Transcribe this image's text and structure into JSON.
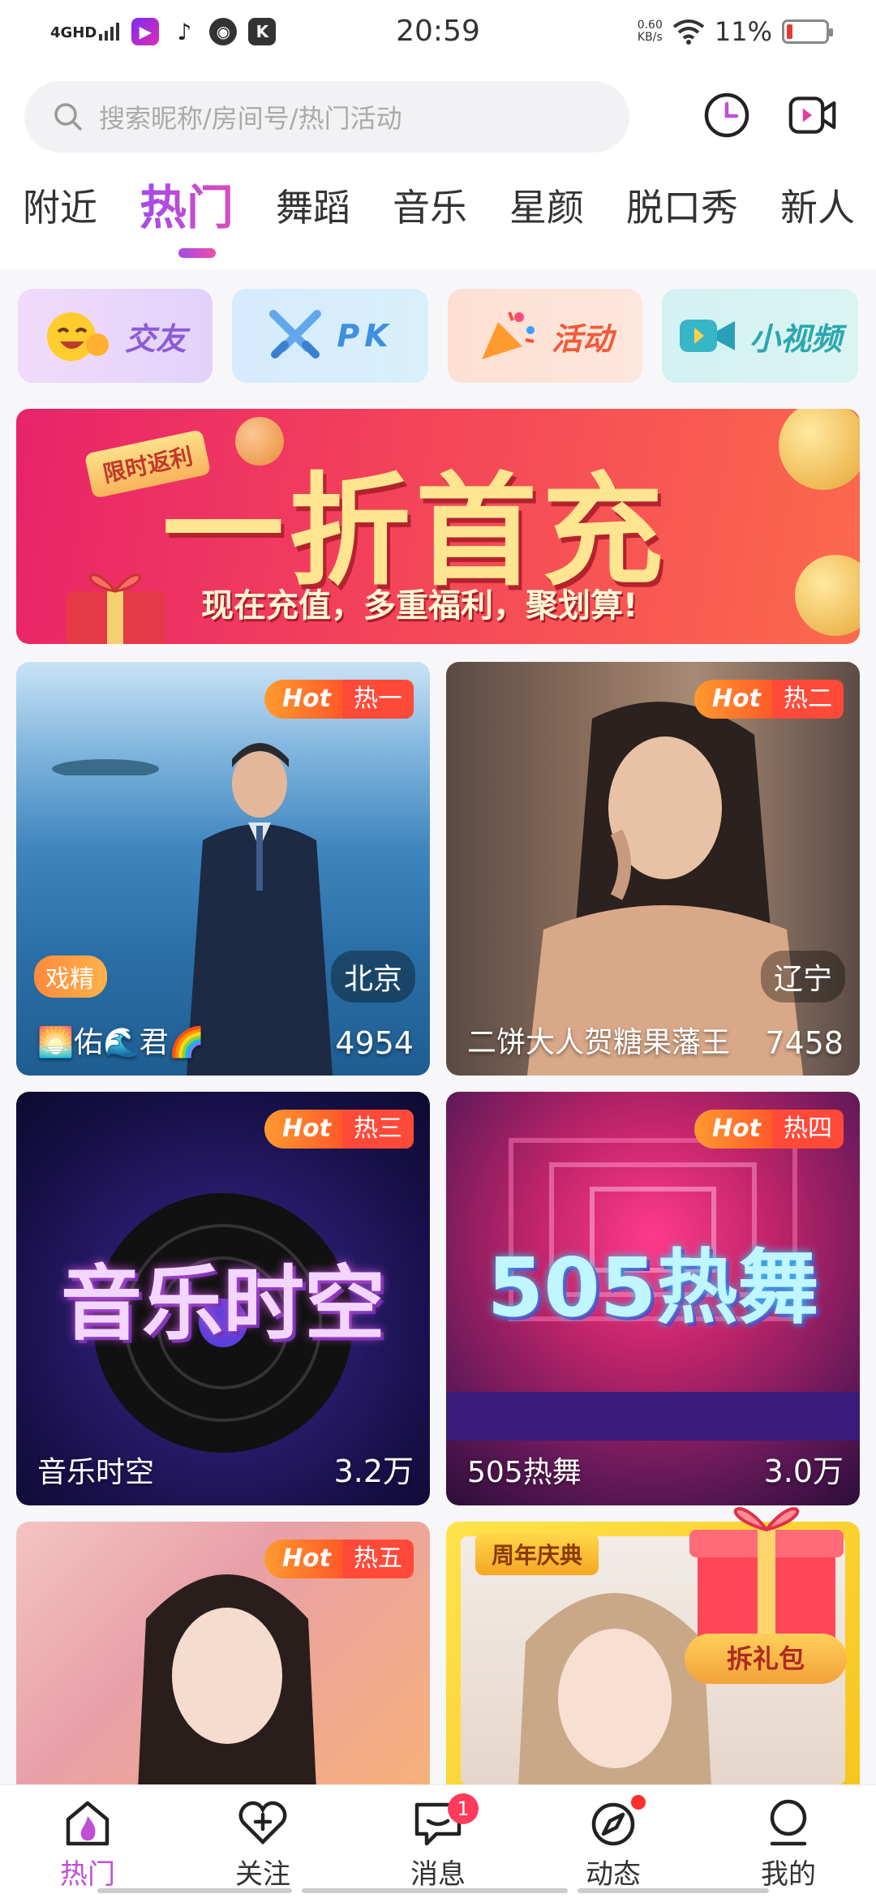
{
  "status_bar": {
    "network": "4GHD",
    "time": "20:59",
    "net_speed_value": "0.60",
    "net_speed_unit": "KB/s",
    "battery": "11%",
    "battery_level": 0.11
  },
  "search": {
    "placeholder": "搜索昵称/房间号/热门活动"
  },
  "tabs": [
    {
      "label": "附近"
    },
    {
      "label": "热门"
    },
    {
      "label": "舞蹈"
    },
    {
      "label": "音乐"
    },
    {
      "label": "星颜"
    },
    {
      "label": "脱口秀"
    },
    {
      "label": "新人"
    }
  ],
  "active_tab": "热门",
  "quick_links": [
    {
      "label": "交友",
      "icon": "laughing-emoji-icon",
      "bg": "#ead7fb",
      "color": "#8b5bd8"
    },
    {
      "label": "PK",
      "icon": "crossed-swords-icon",
      "bg": "#d8ecfb",
      "color": "#3f8fe0"
    },
    {
      "label": "活动",
      "icon": "party-popper-icon",
      "bg": "#fde3d7",
      "color": "#f05a3a"
    },
    {
      "label": "小视频",
      "icon": "video-camera-icon",
      "bg": "#d6f3f3",
      "color": "#2aa7b0"
    }
  ],
  "banner": {
    "badge": "限时返利",
    "headline": "一折首充",
    "subtitle": "现在充值，多重福利，聚划算!"
  },
  "rooms": [
    {
      "title": "🌅佑🌊君🌈",
      "count": "4954",
      "rank": "热一",
      "hot": "Hot",
      "location": "北京",
      "tag": "戏精"
    },
    {
      "title": "二饼大人贺糖果藩王",
      "count": "7458",
      "rank": "热二",
      "hot": "Hot",
      "location": "辽宁"
    },
    {
      "title": "音乐时空",
      "count": "3.2万",
      "rank": "热三",
      "hot": "Hot",
      "cover_text": "音乐时空"
    },
    {
      "title": "505热舞",
      "count": "3.0万",
      "rank": "热四",
      "hot": "Hot",
      "cover_text": "505热舞"
    },
    {
      "rank": "热五",
      "hot": "Hot"
    },
    {
      "badge": "周年庆典",
      "gift_label": "拆礼包"
    }
  ],
  "bottom_nav": [
    {
      "label": "热门",
      "icon": "fire-home-icon",
      "active": true
    },
    {
      "label": "关注",
      "icon": "heart-plus-icon"
    },
    {
      "label": "消息",
      "icon": "chat-bubble-icon",
      "badge": "1"
    },
    {
      "label": "动态",
      "icon": "compass-icon",
      "dot": true
    },
    {
      "label": "我的",
      "icon": "profile-icon"
    }
  ],
  "colors": {
    "accent": "#c04fd6",
    "hot": "#ff4a3a"
  }
}
